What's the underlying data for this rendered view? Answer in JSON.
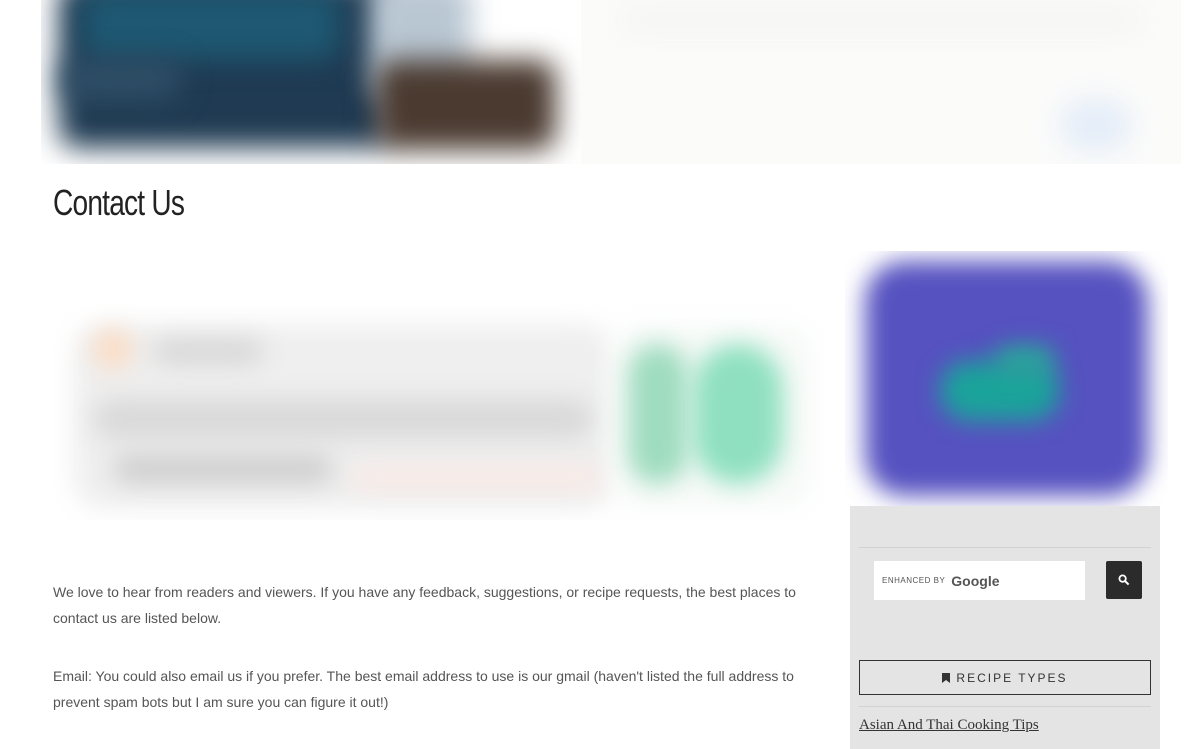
{
  "page": {
    "title": "Contact Us",
    "paragraphs": [
      "We love to hear from readers and viewers. If you have any feedback, suggestions, or recipe requests, the best places to contact us are listed below.",
      "Email: You could also email us if you prefer. The best email address to use is our gmail (haven't listed the full address to prevent spam bots but I am sure you can figure it out!)"
    ]
  },
  "sidebar": {
    "search": {
      "enhanced_by": "ENHANCED BY",
      "brand": "Google",
      "button_icon": "search-icon"
    },
    "widget_title": "RECIPE TYPES",
    "widget_icon": "bookmark-icon",
    "links": [
      "Asian And Thai Cooking Tips"
    ]
  },
  "colors": {
    "ad_purple": "#5652c0",
    "ad_teal": "#1aa49a",
    "sidebar_bg": "#e4e4e4",
    "search_button": "#2b2b2b",
    "text": "#555555"
  }
}
